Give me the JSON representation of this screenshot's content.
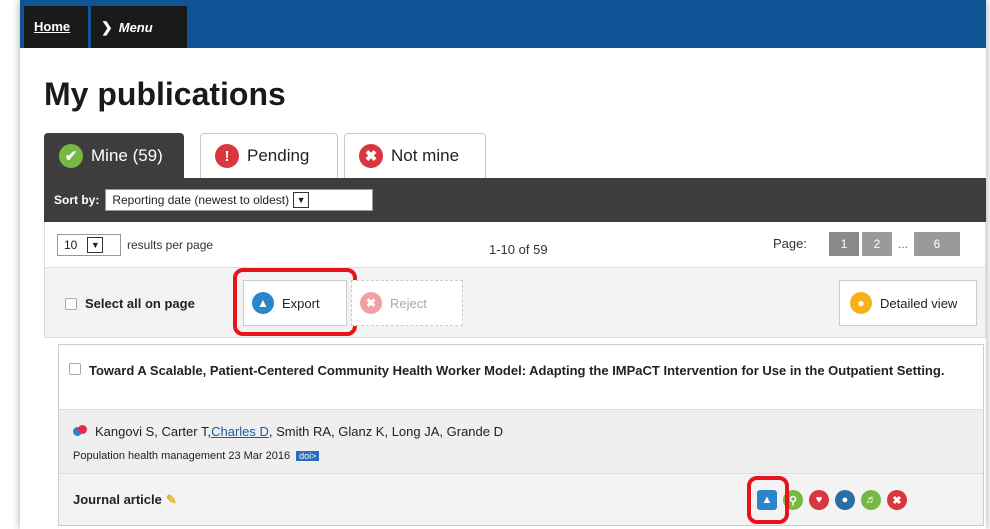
{
  "nav": {
    "home": "Home",
    "menu": "Menu"
  },
  "page_title": "My publications",
  "tabs": [
    {
      "label": "Mine (59)",
      "icon": "check-icon"
    },
    {
      "label": "Pending",
      "icon": "exclamation-icon"
    },
    {
      "label": "Not mine",
      "icon": "close-icon"
    }
  ],
  "sort": {
    "label": "Sort by:",
    "value": "Reporting date (newest to oldest)"
  },
  "results": {
    "per_page_value": "10",
    "per_page_label": "results per page",
    "range": "1-10 of 59",
    "page_label": "Page:",
    "pages": [
      "1",
      "2",
      "...",
      "6"
    ]
  },
  "actions": {
    "select_all": "Select all on page",
    "export": "Export",
    "reject": "Reject",
    "detailed_view": "Detailed view"
  },
  "publication": {
    "title": "Toward A Scalable, Patient-Centered Community Health Worker Model: Adapting the IMPaCT Intervention for Use in the Outpatient Setting.",
    "authors_before": "Kangovi S, Carter T, ",
    "author_link": "Charles D",
    "authors_after": ", Smith RA, Glanz K, Long JA, Grande D",
    "journal": "Population health management 23 Mar 2016",
    "doi": "doi>",
    "type": "Journal article"
  },
  "colors": {
    "nav_blue": "#0f5596",
    "dark_bar": "#3d3d3d",
    "highlight_red": "#e8141b",
    "green": "#76b843",
    "red": "#d9363e"
  }
}
